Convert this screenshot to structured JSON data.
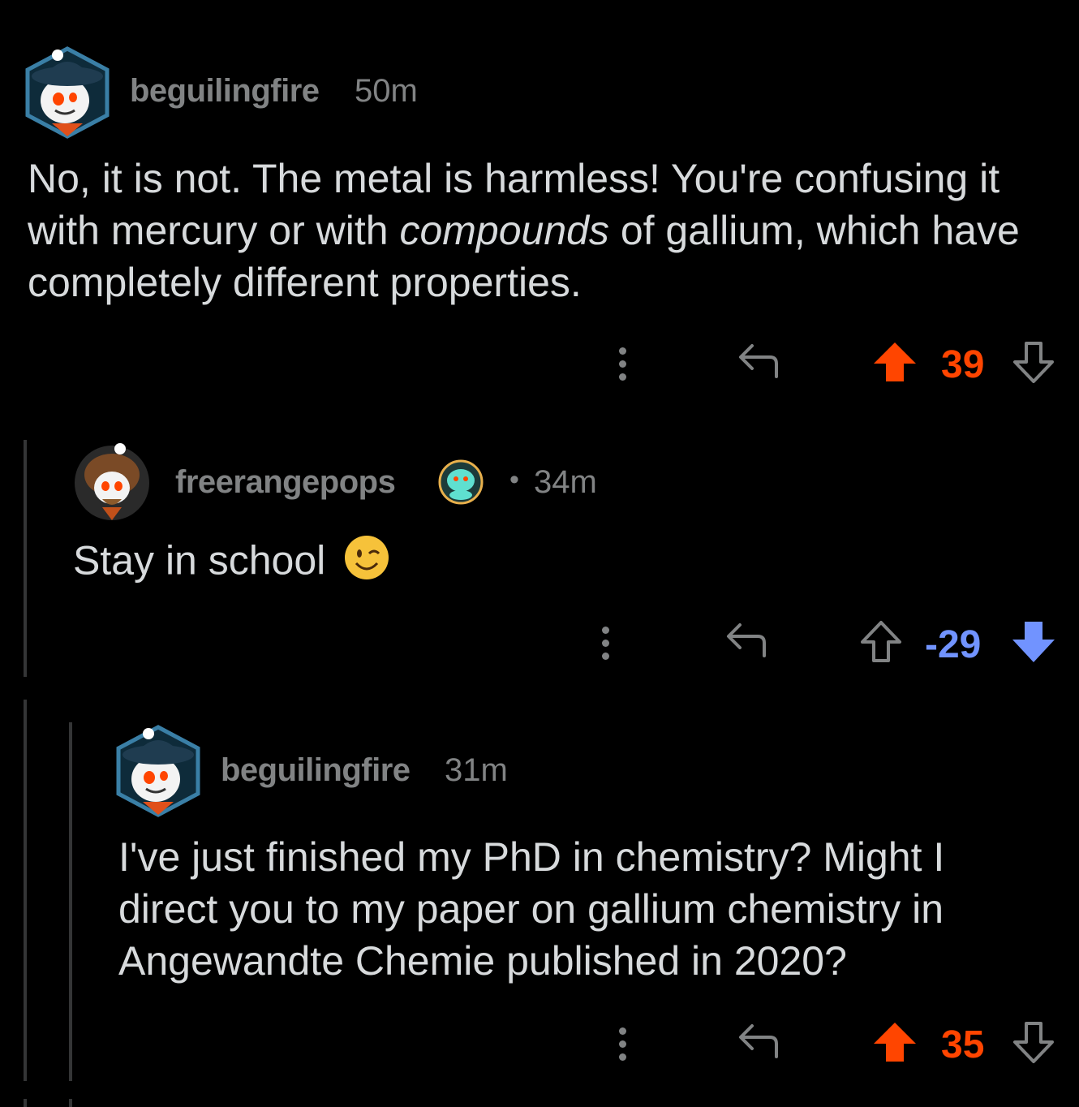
{
  "comments": [
    {
      "username": "beguilingfire",
      "time": "50m",
      "body_plain_1": "No, it is not. The metal is harmless! You're confusing it with mercury or with ",
      "body_italic": "compounds",
      "body_plain_2": " of gallium, which have completely different properties.",
      "score": "39",
      "vote_state": "upvoted"
    },
    {
      "username": "freerangepops",
      "separator": "•",
      "time": "34m",
      "body": "Stay in school",
      "emoji": "😉",
      "score": "-29",
      "vote_state": "downvoted"
    },
    {
      "username": "beguilingfire",
      "time": "31m",
      "body": "I've just finished my PhD in chemistry? Might I direct you to my paper on gallium chemistry in Angewandte Chemie published in 2020?",
      "score": "35",
      "vote_state": "upvoted"
    }
  ],
  "colors": {
    "upvote": "#ff4500",
    "downvote": "#7193ff",
    "muted": "#818384",
    "text": "#d7dadc",
    "background": "#000000"
  },
  "icons": [
    "more-options-icon",
    "reply-icon",
    "upvote-arrow-icon",
    "downvote-arrow-icon",
    "avatar",
    "flair-icon"
  ]
}
